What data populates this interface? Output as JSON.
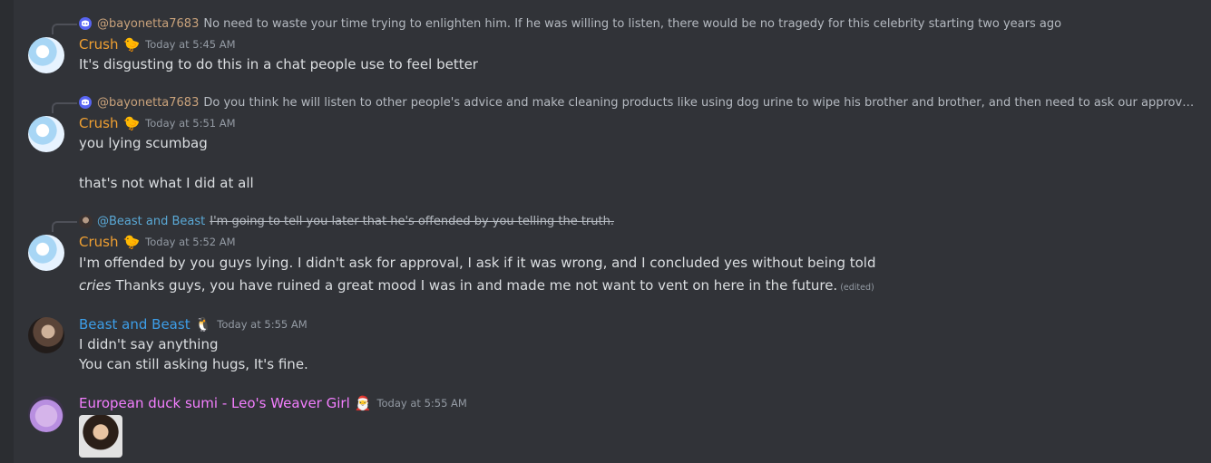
{
  "messages": [
    {
      "reply": {
        "user": "@bayonetta7683",
        "text": "No need to waste your time trying to enlighten him. If he was willing to listen, there would be no tragedy for this celebrity starting two years ago",
        "icon": "discord-icon"
      },
      "author": "Crush",
      "badge": "🐤",
      "timestamp": "Today at 5:45 AM",
      "lines": [
        "It's disgusting to do this in a chat people use to feel better"
      ]
    },
    {
      "reply": {
        "user": "@bayonetta7683",
        "text": "Do you think he will listen to other people's advice and make cleaning products like using dog urine to wipe his brother and brother, and then need to ask our approval whether his behavi...",
        "icon": "discord-icon"
      },
      "author": "Crush",
      "badge": "🐤",
      "timestamp": "Today at 5:51 AM",
      "lines": [
        "you lying scumbag",
        "that's not what I did at all"
      ]
    },
    {
      "reply": {
        "user": "@Beast and Beast",
        "text": "I'm going to tell you later that he's offended by you telling the truth."
      },
      "author": "Crush",
      "badge": "🐤",
      "timestamp": "Today at 5:52 AM",
      "lines": [
        "I'm offended by you guys lying. I didn't ask for approval, I ask if it was wrong, and I concluded yes without being told"
      ],
      "cries": "cries",
      "cries_text": " Thanks guys, you have ruined a great mood I was in and made me not want to vent on here in the future.",
      "edited": "(edited)"
    },
    {
      "author": "Beast and Beast",
      "badge": "🐧",
      "timestamp": "Today at 5:55 AM",
      "lines": [
        "I didn't say anything",
        "You can still asking hugs, It's fine."
      ]
    },
    {
      "author": "European duck sumi - Leo's Weaver Girl",
      "badge": "🎅",
      "timestamp": "Today at 5:55 AM"
    }
  ]
}
